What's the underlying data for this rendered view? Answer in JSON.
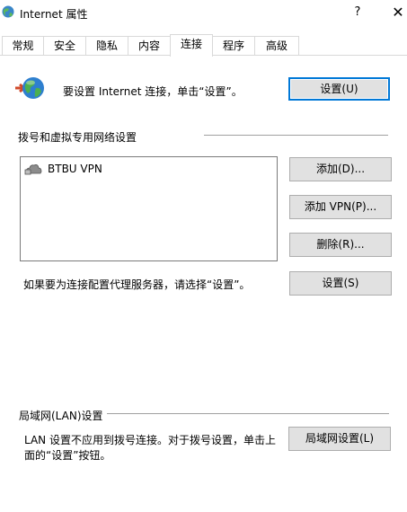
{
  "window": {
    "title": "Internet 属性",
    "help_glyph": "?",
    "close_glyph": "✕"
  },
  "tabs": [
    "常规",
    "安全",
    "隐私",
    "内容",
    "连接",
    "程序",
    "高级"
  ],
  "active_tab": "连接",
  "setup": {
    "text": "要设置 Internet 连接，单击“设置”。",
    "button": "设置(U)"
  },
  "dialup": {
    "group_title": "拨号和虚拟专用网络设置",
    "items": [
      "BTBU VPN"
    ],
    "buttons": {
      "add": "添加(D)...",
      "add_vpn": "添加 VPN(P)...",
      "remove": "删除(R)...",
      "settings": "设置(S)"
    },
    "proxy_text": "如果要为连接配置代理服务器，请选择“设置”。"
  },
  "lan": {
    "group_title": "局域网(LAN)设置",
    "text": "LAN 设置不应用到拨号连接。对于拨号设置，单击上面的“设置”按钮。",
    "button": "局域网设置(L)"
  },
  "icons": {
    "app": "internet-options-icon",
    "globe": "globe-network-icon",
    "vpn": "vpn-connection-icon"
  },
  "colors": {
    "default_button_border": "#0078d7",
    "button_face": "#e1e1e1"
  }
}
